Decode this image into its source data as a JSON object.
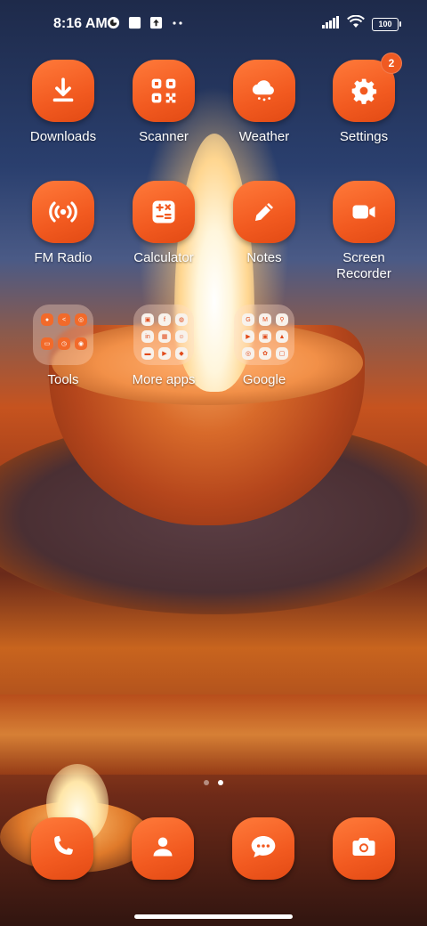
{
  "status_bar": {
    "time": "8:16 AM",
    "battery": "100",
    "icons": [
      "vpn-icon",
      "notification-square-icon",
      "upload-icon",
      "more-dots-icon",
      "signal-icon",
      "wifi-icon",
      "battery-icon"
    ]
  },
  "apps": [
    {
      "label": "Downloads",
      "icon": "download-icon"
    },
    {
      "label": "Scanner",
      "icon": "qr-scanner-icon"
    },
    {
      "label": "Weather",
      "icon": "weather-cloud-icon"
    },
    {
      "label": "Settings",
      "icon": "gear-icon",
      "badge": "2"
    },
    {
      "label": "FM Radio",
      "icon": "radio-icon"
    },
    {
      "label": "Calculator",
      "icon": "calculator-icon"
    },
    {
      "label": "Notes",
      "icon": "pencil-icon"
    },
    {
      "label": "Screen\nRecorder",
      "icon": "video-camera-icon"
    }
  ],
  "folders": [
    {
      "label": "Tools"
    },
    {
      "label": "More apps"
    },
    {
      "label": "Google"
    }
  ],
  "page_indicator": {
    "count": 2,
    "active": 2
  },
  "dock": [
    {
      "icon": "phone-icon"
    },
    {
      "icon": "contacts-icon"
    },
    {
      "icon": "messages-icon"
    },
    {
      "icon": "camera-icon"
    }
  ],
  "colors": {
    "accent": "#f25a20",
    "badge": "#ef5a22"
  }
}
